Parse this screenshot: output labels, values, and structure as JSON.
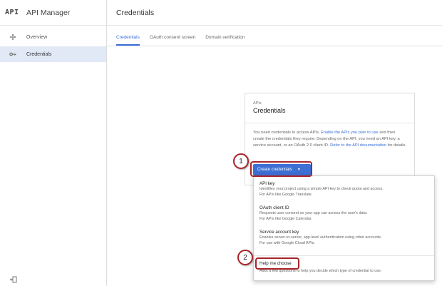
{
  "app": {
    "logo": "API",
    "title": "API Manager"
  },
  "sidebar": {
    "items": [
      {
        "label": "Overview",
        "icon": "diamond-nav-icon",
        "active": false
      },
      {
        "label": "Credentials",
        "icon": "key-icon",
        "active": true
      }
    ]
  },
  "header": {
    "title": "Credentials"
  },
  "tabs": [
    {
      "label": "Credentials",
      "active": true
    },
    {
      "label": "OAuth consent screen",
      "active": false
    },
    {
      "label": "Domain verification",
      "active": false
    }
  ],
  "card": {
    "kicker": "APIs",
    "title": "Credentials",
    "body_1": "You need credentials to access APIs. ",
    "body_link_1": "Enable the APIs you plan to use",
    "body_2": " and then create the credentials they require. Depending on the API, you need an API key, a service account, or an OAuth 2.0 client ID. ",
    "body_link_2": "Refer to the API documentation",
    "body_3": " for details.",
    "button": "Create credentials"
  },
  "menu": {
    "items": [
      {
        "title": "API key",
        "desc_1": "Identifies your project using a simple API key to check quota and access.",
        "desc_2": "For APIs like Google Translate."
      },
      {
        "title": "OAuth client ID",
        "desc_1": "Requests user consent so your app can access the user's data.",
        "desc_2": "For APIs like Google Calendar."
      },
      {
        "title": "Service account key",
        "desc_1": "Enables server-to-server, app-level authentication using robot accounts.",
        "desc_2": "For use with Google Cloud APIs."
      }
    ],
    "help": {
      "title": "Help me choose",
      "desc": "Asks a few questions to help you decide which type of credential to use."
    }
  },
  "callouts": [
    {
      "number": "1"
    },
    {
      "number": "2"
    }
  ],
  "colors": {
    "accent": "#3d6fd5",
    "callout": "#a8242a",
    "active_nav": "#e1e8f6"
  }
}
